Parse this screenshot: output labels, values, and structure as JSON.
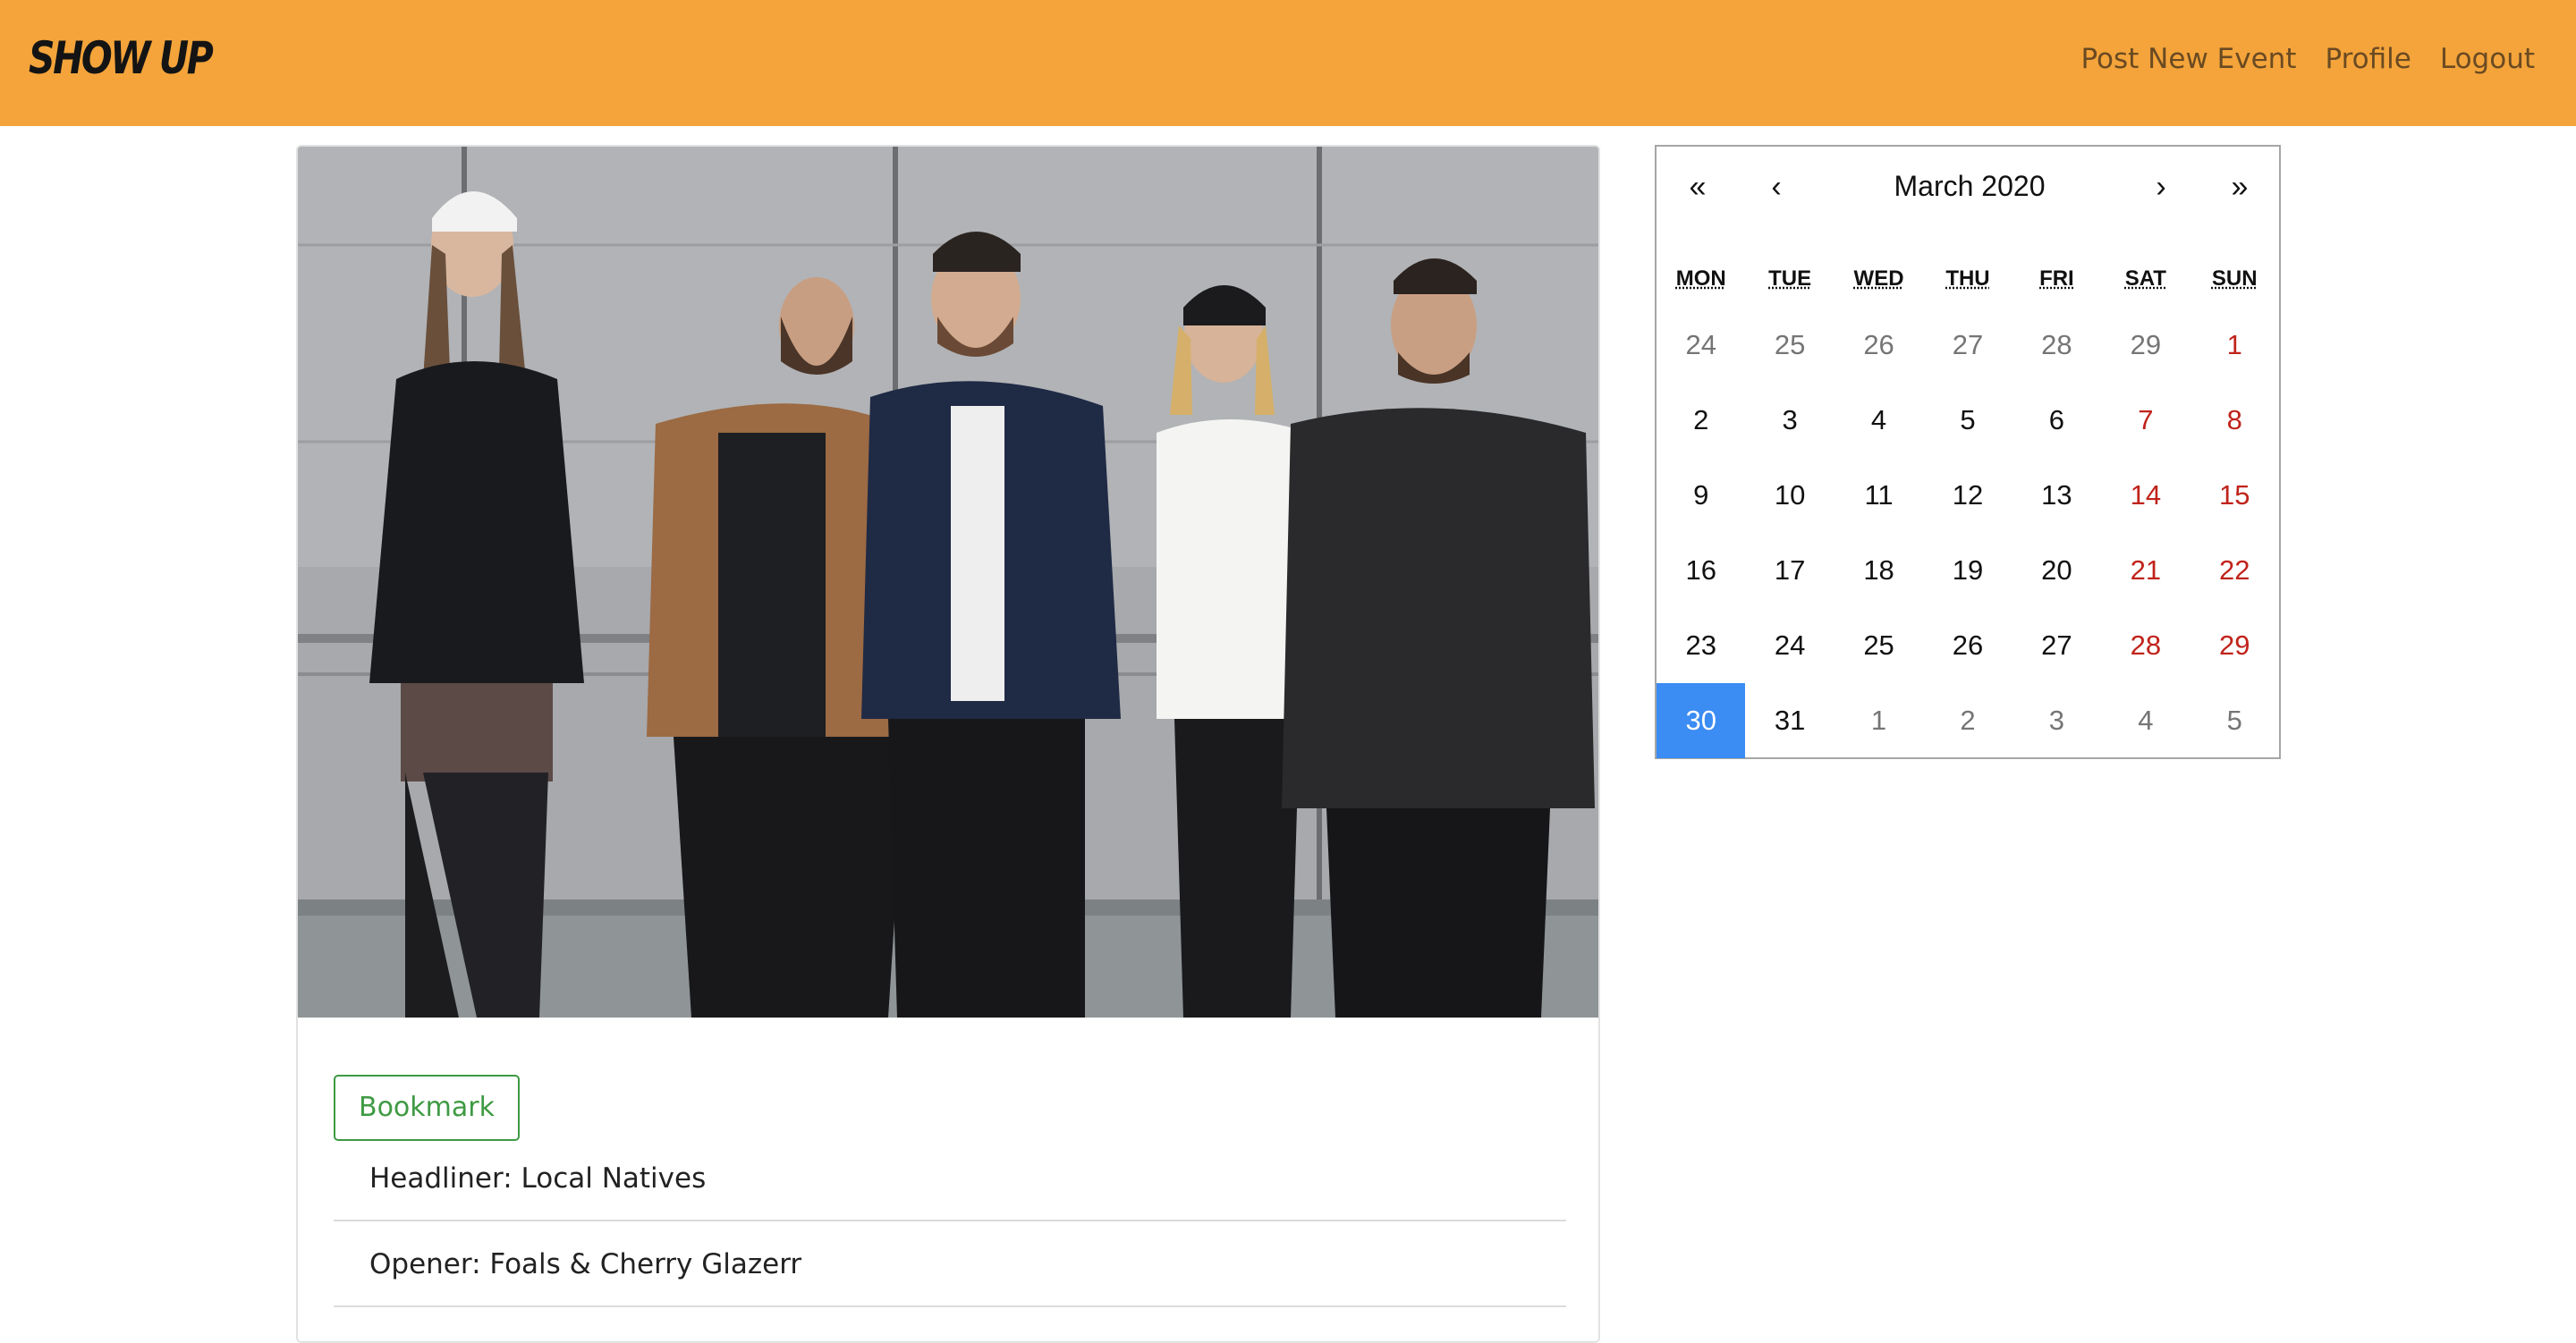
{
  "navbar": {
    "brand": "SHOW UP",
    "links": [
      "Post New Event",
      "Profile",
      "Logout"
    ]
  },
  "event": {
    "bookmark_label": "Bookmark",
    "details": [
      "Headliner: Local Natives",
      "Opener: Foals & Cherry Glazerr"
    ]
  },
  "calendar": {
    "nav": {
      "prev_year": "«",
      "prev_month": "‹",
      "next_month": "›",
      "next_year": "»"
    },
    "label": "March 2020",
    "weekdays": [
      "MON",
      "TUE",
      "WED",
      "THU",
      "FRI",
      "SAT",
      "SUN"
    ],
    "weeks": [
      [
        {
          "d": "24",
          "s": "muted"
        },
        {
          "d": "25",
          "s": "muted"
        },
        {
          "d": "26",
          "s": "muted"
        },
        {
          "d": "27",
          "s": "muted"
        },
        {
          "d": "28",
          "s": "muted"
        },
        {
          "d": "29",
          "s": "muted"
        },
        {
          "d": "1",
          "s": "weekend"
        }
      ],
      [
        {
          "d": "2"
        },
        {
          "d": "3"
        },
        {
          "d": "4"
        },
        {
          "d": "5"
        },
        {
          "d": "6"
        },
        {
          "d": "7",
          "s": "weekend"
        },
        {
          "d": "8",
          "s": "weekend"
        }
      ],
      [
        {
          "d": "9"
        },
        {
          "d": "10"
        },
        {
          "d": "11"
        },
        {
          "d": "12"
        },
        {
          "d": "13"
        },
        {
          "d": "14",
          "s": "weekend"
        },
        {
          "d": "15",
          "s": "weekend"
        }
      ],
      [
        {
          "d": "16"
        },
        {
          "d": "17"
        },
        {
          "d": "18"
        },
        {
          "d": "19"
        },
        {
          "d": "20"
        },
        {
          "d": "21",
          "s": "weekend"
        },
        {
          "d": "22",
          "s": "weekend"
        }
      ],
      [
        {
          "d": "23"
        },
        {
          "d": "24"
        },
        {
          "d": "25"
        },
        {
          "d": "26"
        },
        {
          "d": "27"
        },
        {
          "d": "28",
          "s": "weekend"
        },
        {
          "d": "29",
          "s": "weekend"
        }
      ],
      [
        {
          "d": "30",
          "s": "selected"
        },
        {
          "d": "31"
        },
        {
          "d": "1",
          "s": "muted"
        },
        {
          "d": "2",
          "s": "muted"
        },
        {
          "d": "3",
          "s": "muted"
        },
        {
          "d": "4",
          "s": "muted"
        },
        {
          "d": "5",
          "s": "muted"
        }
      ]
    ]
  },
  "colors": {
    "navbar": "#f4a43a",
    "bookmark": "#3e9a43",
    "weekend": "#c0231b",
    "selected": "#3b8cf3"
  }
}
